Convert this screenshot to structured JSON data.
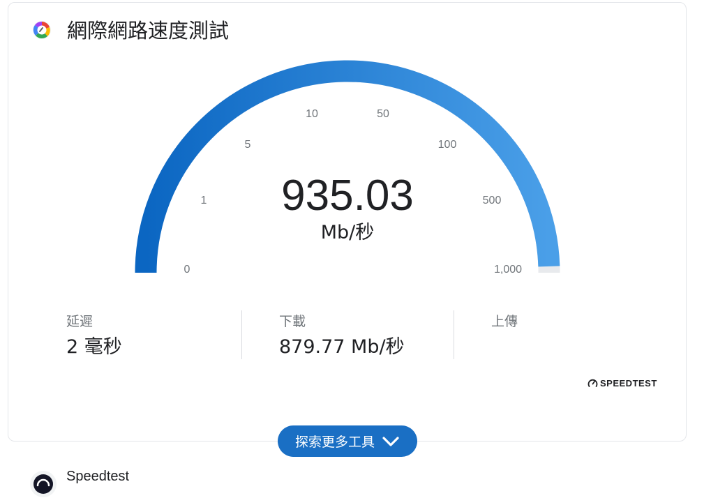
{
  "card": {
    "title": "網際網路速度測試",
    "icon": "speed-test-multicolor-icon"
  },
  "gauge": {
    "value": "935.03",
    "unit": "Mb/秒",
    "scale": "log",
    "fill_fraction": 0.99,
    "ticks": [
      "0",
      "1",
      "5",
      "10",
      "50",
      "100",
      "500",
      "1,000"
    ],
    "colors": {
      "fill_start": "#0b66c2",
      "fill_end": "#4a9fe8",
      "track": "#e8eaed"
    }
  },
  "stats": {
    "latency": {
      "label": "延遲",
      "value": "2 毫秒"
    },
    "download": {
      "label": "下載",
      "value": "879.77 Mb/秒"
    },
    "upload": {
      "label": "上傳",
      "value": ""
    }
  },
  "branding": {
    "speedtest_logo_text": "SPEEDTEST",
    "icon": "speedometer-icon"
  },
  "explore_button": {
    "label": "探索更多工具",
    "icon": "chevron-down-icon",
    "color": "#1a6fc4"
  },
  "result": {
    "title": "Speedtest",
    "icon": "speedtest-logo-icon"
  }
}
